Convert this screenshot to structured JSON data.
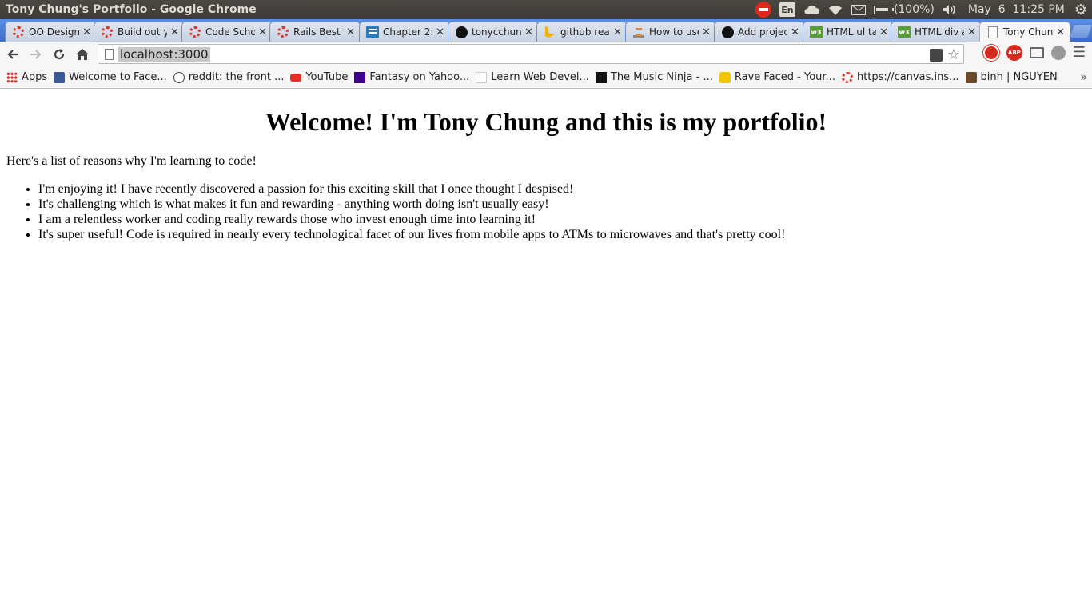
{
  "window": {
    "title": "Tony Chung's Portfolio - Google Chrome"
  },
  "system_tray": {
    "keyboard_layout": "En",
    "battery": "(100%)",
    "clock": "May  6  11:25 PM"
  },
  "tabs": [
    {
      "label": "OO Design",
      "favicon": "ring-icon"
    },
    {
      "label": "Build out y",
      "favicon": "ring-icon"
    },
    {
      "label": "Code Scho",
      "favicon": "ring-icon"
    },
    {
      "label": "Rails Best",
      "favicon": "ring-icon"
    },
    {
      "label": "Chapter 2:",
      "favicon": "doc-icon"
    },
    {
      "label": "tonycchun",
      "favicon": "github-icon"
    },
    {
      "label": "github rea",
      "favicon": "bing-icon"
    },
    {
      "label": "How to use",
      "favicon": "stackoverflow-icon"
    },
    {
      "label": "Add projec",
      "favicon": "github-icon"
    },
    {
      "label": "HTML ul ta",
      "favicon": "w3schools-icon"
    },
    {
      "label": "HTML div a",
      "favicon": "w3schools-icon"
    },
    {
      "label": "Tony Chun",
      "favicon": "page-icon",
      "active": true
    }
  ],
  "omnibox": {
    "url": "localhost:3000"
  },
  "bookmarks": [
    {
      "label": "Apps"
    },
    {
      "label": "Welcome to Face..."
    },
    {
      "label": "reddit: the front ..."
    },
    {
      "label": "YouTube"
    },
    {
      "label": "Fantasy on Yahoo..."
    },
    {
      "label": "Learn Web Devel..."
    },
    {
      "label": "The Music Ninja - ..."
    },
    {
      "label": "Rave Faced - Your..."
    },
    {
      "label": "https://canvas.ins..."
    },
    {
      "label": "binh | NGUYEN"
    }
  ],
  "bookmarks_more": "»",
  "page": {
    "heading": "Welcome! I'm Tony Chung and this is my portfolio!",
    "intro": "Here's a list of reasons why I'm learning to code!",
    "reasons": [
      "I'm enjoying it! I have recently discovered a passion for this exciting skill that I once thought I despised!",
      "It's challenging which is what makes it fun and rewarding - anything worth doing isn't usually easy!",
      "I am a relentless worker and coding really rewards those who invest enough time into learning it!",
      "It's super useful! Code is required in nearly every technological facet of our lives from mobile apps to ATMs to microwaves and that's pretty cool!"
    ]
  }
}
